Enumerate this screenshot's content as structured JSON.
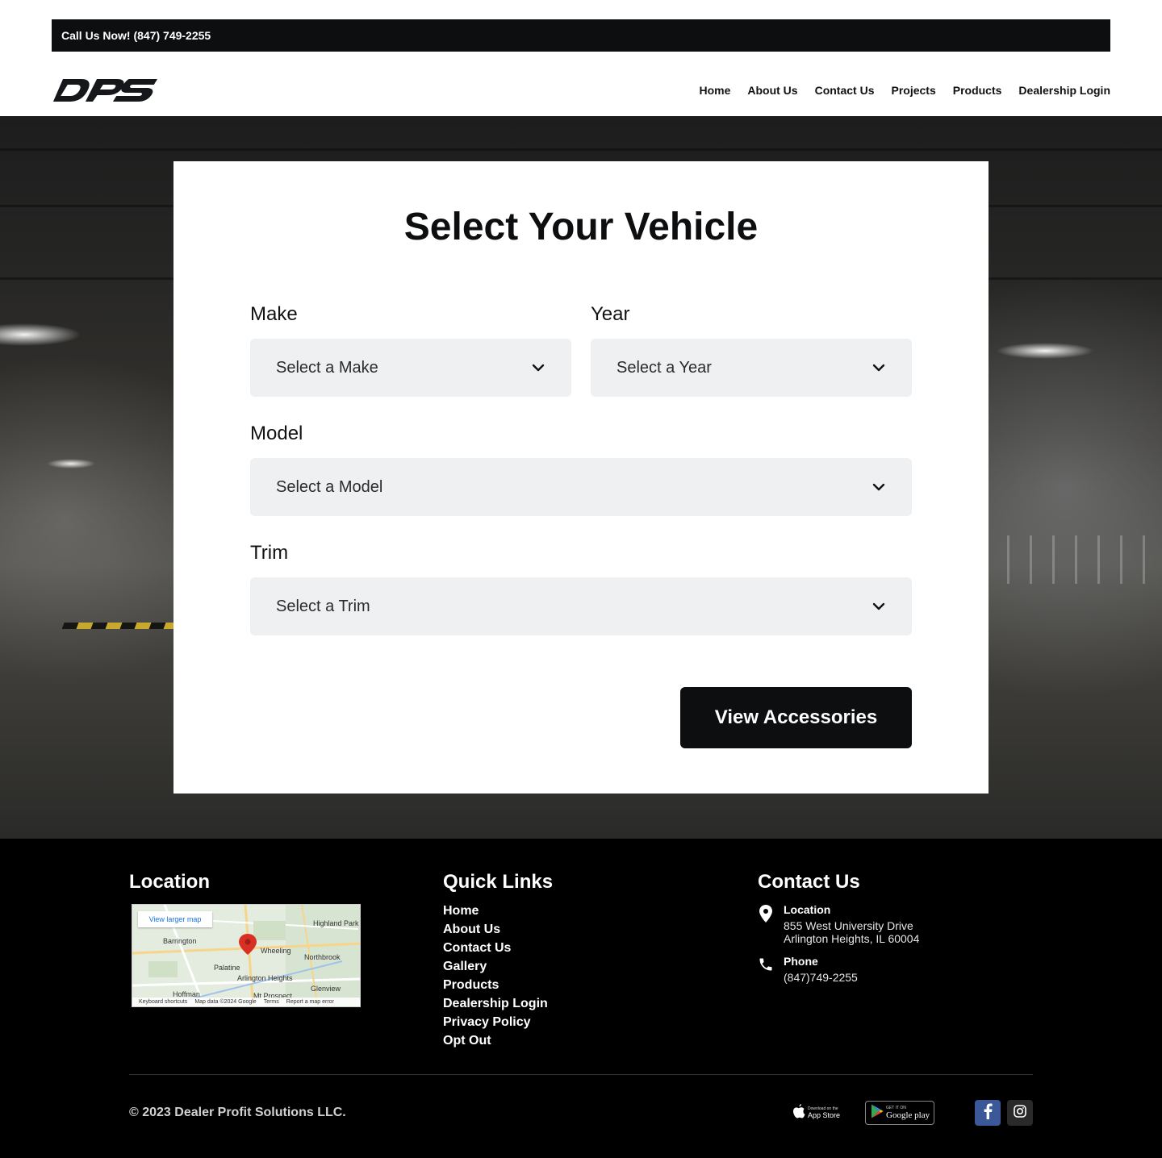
{
  "topbar": {
    "call_text": "Call Us Now! (847) 749-2255"
  },
  "header": {
    "logo_text": "DPS",
    "nav": [
      "Home",
      "About Us",
      "Contact Us",
      "Projects",
      "Products",
      "Dealership Login"
    ]
  },
  "form": {
    "title": "Select Your Vehicle",
    "make_label": "Make",
    "make_value": "Select a Make",
    "year_label": "Year",
    "year_value": "Select a Year",
    "model_label": "Model",
    "model_value": "Select a Model",
    "trim_label": "Trim",
    "trim_value": "Select a Trim",
    "submit_label": "View Accessories"
  },
  "footer": {
    "location_heading": "Location",
    "map": {
      "view_larger": "View larger map",
      "towns": [
        "Highland Park",
        "Barrington",
        "Wheeling",
        "Northbrook",
        "Palatine",
        "Arlington Heights",
        "Glenview",
        "Hoffman",
        "Mt Prospect"
      ],
      "attribution": [
        "Keyboard shortcuts",
        "Map data ©2024 Google",
        "Terms",
        "Report a map error"
      ]
    },
    "quick_links_heading": "Quick Links",
    "quick_links": [
      "Home",
      "About Us",
      "Contact Us",
      "Gallery",
      "Products",
      "Dealership Login",
      "Privacy Policy",
      "Opt Out"
    ],
    "contact_heading": "Contact Us",
    "contact": {
      "location_title": "Location",
      "address_line1": "855 West University Drive",
      "address_line2": "Arlington Heights, IL 60004",
      "phone_title": "Phone",
      "phone": "(847)749-2255"
    },
    "copyright": "© 2023 Dealer Profit Solutions LLC.",
    "appstore": {
      "small": "Download on the",
      "big": "App Store"
    },
    "googleplay": {
      "small": "GET IT ON",
      "big": "Google play"
    },
    "social": [
      "facebook-icon",
      "instagram-icon"
    ]
  }
}
